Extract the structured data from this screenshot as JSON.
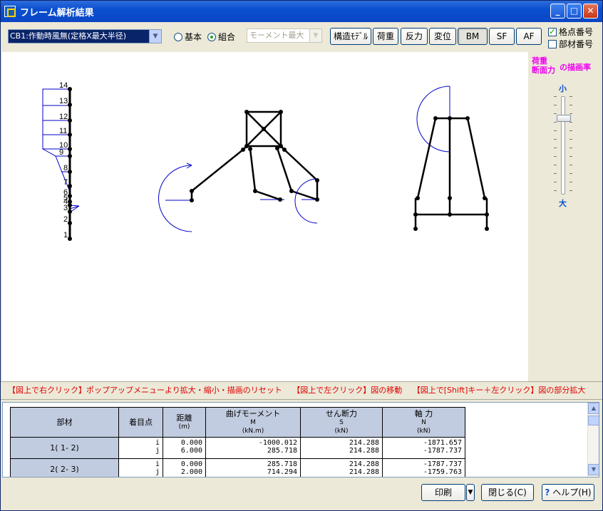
{
  "window": {
    "title": "フレーム解析結果",
    "minimize": "_",
    "maximize": "□",
    "close": "✕"
  },
  "toolbar": {
    "case_select": "CB1:作動時風無(定格X最大半径)",
    "radio_basic": "基本",
    "radio_combined": "組合",
    "mode_select": "モーメント最大",
    "btn_model": "構造ﾓﾃﾞﾙ",
    "btn_load": "荷重",
    "btn_reaction": "反力",
    "btn_displacement": "変位",
    "btn_bm": "BM",
    "btn_sf": "SF",
    "btn_af": "AF",
    "chk_node": "格点番号",
    "chk_member": "部材番号"
  },
  "right_panel": {
    "label_line1": "荷重",
    "label_line2": "断面力",
    "label_suffix": "の描画率",
    "slider_small": "小",
    "slider_large": "大"
  },
  "canvas": {
    "node_labels": [
      "14",
      "13",
      "12",
      "11",
      "10",
      "9",
      "8",
      "7",
      "6",
      "5",
      "4",
      "3",
      "2",
      "1"
    ]
  },
  "info_bar": "【図上で右クリック】ポップアップメニューより拡大・縮小・描画のリセット　 【図上で左クリック】図の移動　 【図上で[Shift]キー＋左クリック】図の部分拡大",
  "table": {
    "headers": {
      "member": "部材",
      "point": "着目点",
      "distance": "距離",
      "distance_unit": "(m)",
      "moment": "曲げモーメント",
      "moment_sym": "M",
      "moment_unit": "(kN.m)",
      "shear": "せん断力",
      "shear_sym": "S",
      "shear_unit": "(kN)",
      "axial": "軸 力",
      "axial_sym": "N",
      "axial_unit": "(kN)"
    },
    "rows": [
      {
        "member": "1( 1- 2)",
        "point": "i\nj",
        "distance": "0.000\n6.000",
        "moment": "-1000.012\n285.718",
        "shear": "214.288\n214.288",
        "axial": "-1871.657\n-1787.737"
      },
      {
        "member": "2( 2- 3)",
        "point": "i\nj",
        "distance": "0.000\n2.000",
        "moment": "285.718\n714.294",
        "shear": "214.288\n214.288",
        "axial": "-1787.737\n-1759.763"
      }
    ]
  },
  "buttons": {
    "print": "印刷",
    "print_arrow": "▼",
    "close": "閉じる(C)",
    "help": "ヘルプ(H)",
    "help_icon": "?"
  }
}
